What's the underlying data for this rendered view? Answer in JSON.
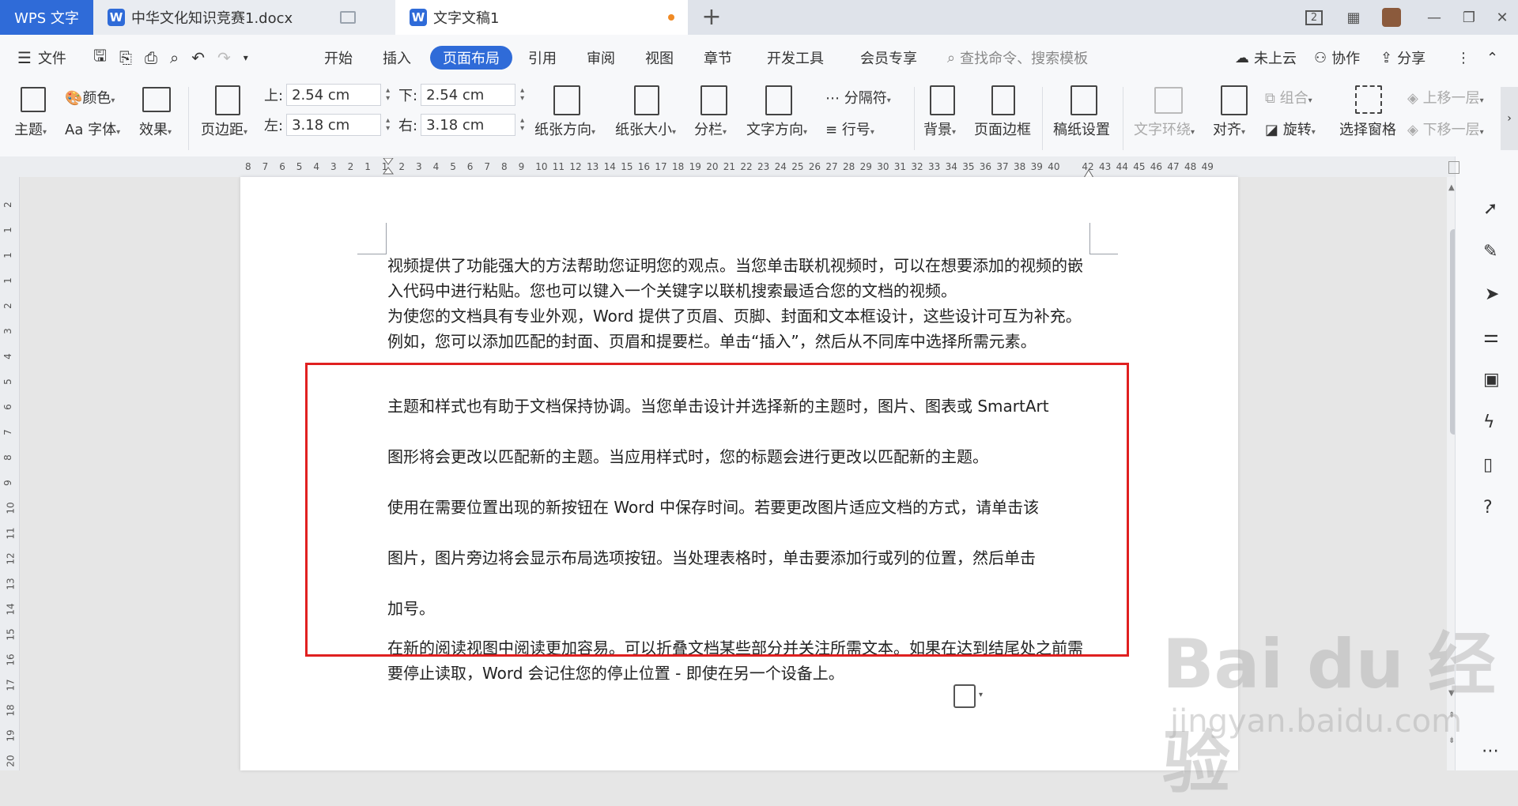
{
  "tabbar": {
    "app_label": "WPS 文字",
    "tab1_label": "中华文化知识竞赛1.docx",
    "tab2_label": "文字文稿1",
    "doc_icon_letter": "W",
    "plus": "+",
    "page_badge": "2"
  },
  "menu": {
    "file": "文件",
    "items": [
      "开始",
      "插入",
      "页面布局",
      "引用",
      "审阅",
      "视图",
      "章节",
      "开发工具",
      "会员专享"
    ],
    "search_placeholder": "查找命令、搜索模板",
    "cloud": "未上云",
    "collab": "协作",
    "share": "分享"
  },
  "ribbon": {
    "theme": "主题",
    "color": "颜色",
    "font": "字体",
    "effect": "效果",
    "margins": "页边距",
    "top_label": "上:",
    "top_value": "2.54 cm",
    "bottom_label": "下:",
    "bottom_value": "2.54 cm",
    "left_label": "左:",
    "left_value": "3.18 cm",
    "right_label": "右:",
    "right_value": "3.18 cm",
    "orientation": "纸张方向",
    "size": "纸张大小",
    "columns": "分栏",
    "text_direction": "文字方向",
    "separator": "分隔符",
    "line_number": "行号",
    "background": "背景",
    "page_border": "页面边框",
    "manuscript": "稿纸设置",
    "text_wrap": "文字环绕",
    "align": "对齐",
    "group": "组合",
    "rotate": "旋转",
    "select_pane": "选择窗格",
    "bring_forward": "上移一层",
    "send_backward": "下移一层"
  },
  "ruler": {
    "h_numbers": [
      "8",
      "7",
      "6",
      "5",
      "4",
      "3",
      "2",
      "1",
      "1",
      "2",
      "3",
      "4",
      "5",
      "6",
      "7",
      "8",
      "9",
      "10",
      "11",
      "12",
      "13",
      "14",
      "15",
      "16",
      "17",
      "18",
      "19",
      "20",
      "21",
      "22",
      "23",
      "24",
      "25",
      "26",
      "27",
      "28",
      "29",
      "30",
      "31",
      "32",
      "33",
      "34",
      "35",
      "36",
      "37",
      "38",
      "39",
      "40",
      "42",
      "43",
      "44",
      "45",
      "46",
      "47",
      "48",
      "49"
    ],
    "v_numbers": [
      "2",
      "1",
      "1",
      "1",
      "2",
      "3",
      "4",
      "5",
      "6",
      "7",
      "8",
      "9",
      "10",
      "11",
      "12",
      "13",
      "14",
      "15",
      "16",
      "17",
      "18",
      "19",
      "20"
    ]
  },
  "document": {
    "p1": "视频提供了功能强大的方法帮助您证明您的观点。当您单击联机视频时，可以在想要添加的视频的嵌入代码中进行粘贴。您也可以键入一个关键字以联机搜索最适合您的文档的视频。",
    "p2": "为使您的文档具有专业外观，Word 提供了页眉、页脚、封面和文本框设计，这些设计可互为补充。例如，您可以添加匹配的封面、页眉和提要栏。单击“插入”，然后从不同库中选择所需元素。",
    "p3a": "主题和样式也有助于文档保持协调。当您单击设计并选择新的主题时，图片、图表或 SmartArt",
    "p3b": "图形将会更改以匹配新的主题。当应用样式时，您的标题会进行更改以匹配新的主题。",
    "p4a": "使用在需要位置出现的新按钮在 Word 中保存时间。若要更改图片适应文档的方式，请单击该",
    "p4b": "图片，图片旁边将会显示布局选项按钮。当处理表格时，单击要添加行或列的位置，然后单击",
    "p4c": "加号。",
    "p5": "在新的阅读视图中阅读更加容易。可以折叠文档某些部分并关注所需文本。如果在达到结尾处之前需要停止读取，Word 会记住您的停止位置 - 即使在另一个设备上。"
  },
  "watermark": {
    "main": "Bai du 经验",
    "sub": "jingyan.baidu.com"
  },
  "colors": {
    "accent": "#2f6bd8",
    "highlight_box": "#e02020",
    "unsaved_dot": "#f08a24"
  }
}
